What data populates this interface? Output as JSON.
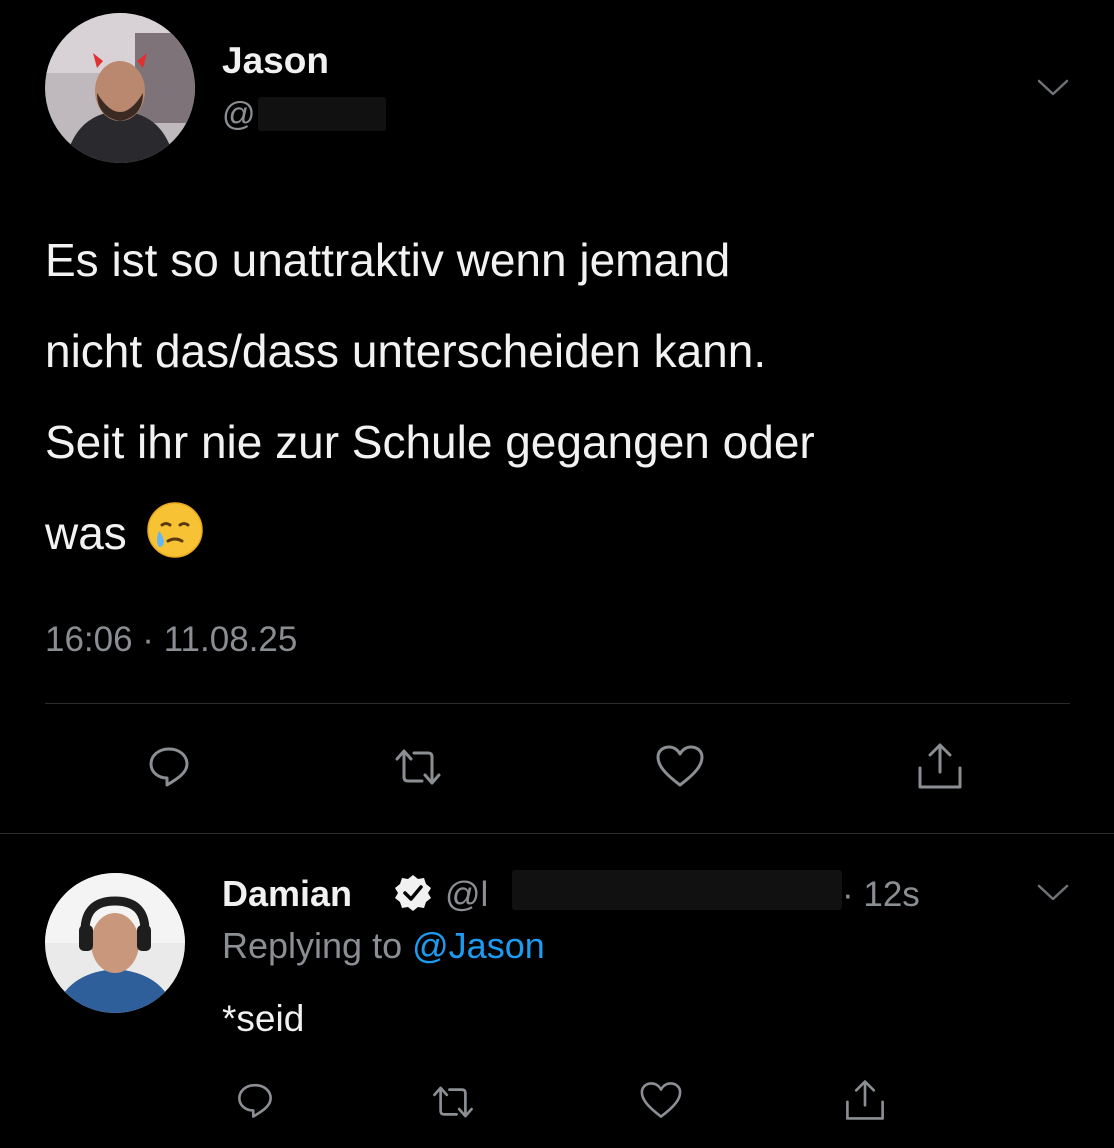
{
  "tweet": {
    "author_name": "Jason",
    "author_handle": "@",
    "text_lines": [
      "Es ist so unattraktiv wenn jemand",
      "nicht das/dass unterscheiden kann.",
      "Seit ihr nie zur Schule gegangen oder",
      "was"
    ],
    "emoji": "face-holding-back-tears",
    "timestamp": "16:06 · 11.08.25"
  },
  "reply": {
    "author_name": "Damian",
    "verified": true,
    "author_handle": "@l",
    "time": "· 12s",
    "replying_prefix": "Replying to",
    "replying_mention": "@Jason",
    "text": "*seid"
  },
  "actions": [
    "reply-icon",
    "retweet-icon",
    "like-icon",
    "share-icon"
  ]
}
